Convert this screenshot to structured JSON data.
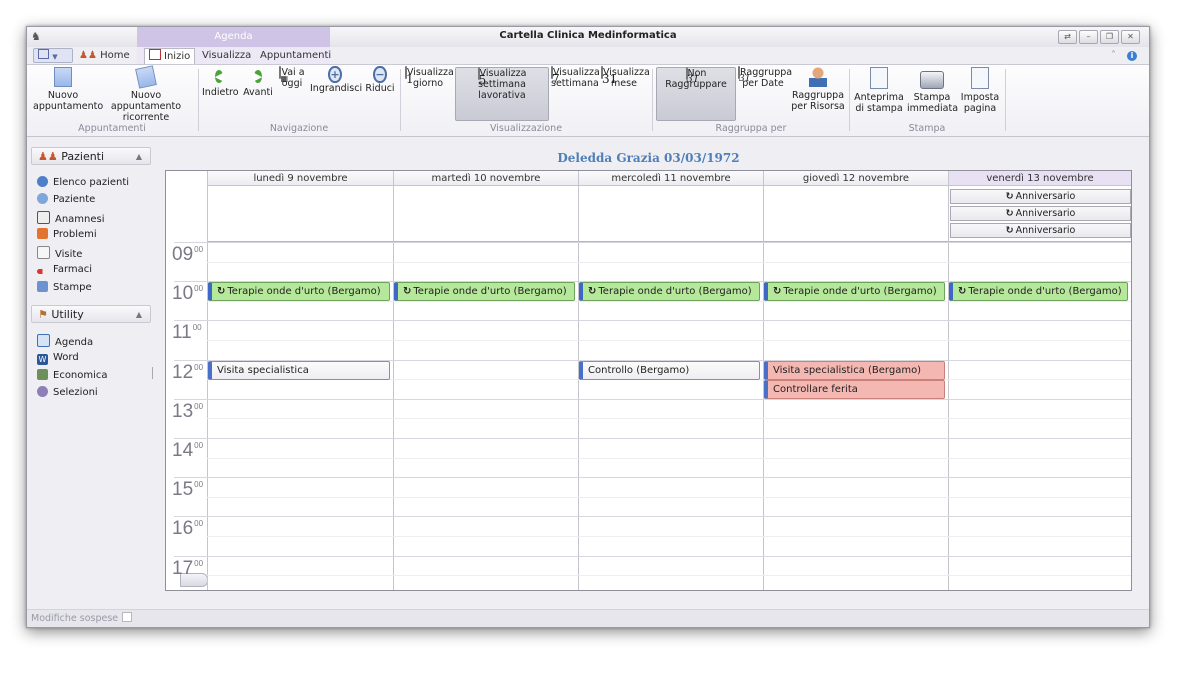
{
  "window": {
    "title": "Cartella Clinica Medinformatica",
    "context_tab_group": "Agenda"
  },
  "tabs": [
    {
      "label": "Home"
    },
    {
      "label": "Inizio"
    },
    {
      "label": "Visualizza"
    },
    {
      "label": "Appuntamenti"
    }
  ],
  "ribbon": {
    "groups": {
      "appuntamenti": "Appuntamenti",
      "navigazione": "Navigazione",
      "visualizzazione": "Visualizzazione",
      "raggruppa": "Raggruppa per",
      "stampa": "Stampa"
    },
    "buttons": {
      "nuovo_line1": "Nuovo",
      "nuovo_line2": "appuntamento",
      "nuovo_ric_line1": "Nuovo appuntamento",
      "nuovo_ric_line2": "ricorrente",
      "indietro": "Indietro",
      "avanti": "Avanti",
      "vai_line1": "Vai a",
      "vai_line2": "oggi",
      "ingrandisci": "Ingrandisci",
      "riduci": "Riduci",
      "vis_giorno_line1": "Visualizza",
      "vis_giorno_line2": "giorno",
      "vis_setlav_line1": "Visualizza settimana",
      "vis_setlav_line2": "lavorativa",
      "vis_set_line1": "Visualizza",
      "vis_set_line2": "settimana",
      "vis_mese_line1": "Visualizza",
      "vis_mese_line2": "mese",
      "non_raggruppare": "Non Raggruppare",
      "ragg_date_line1": "Raggruppa",
      "ragg_date_line2": "per Date",
      "ragg_risorsa_line1": "Raggruppa",
      "ragg_risorsa_line2": "per Risorsa",
      "anteprima_line1": "Anteprima",
      "anteprima_line2": "di stampa",
      "stampa_line1": "Stampa",
      "stampa_line2": "immediata",
      "imposta_line1": "Imposta",
      "imposta_line2": "pagina"
    },
    "calendar_icons": {
      "giorno": "1",
      "settimana_lavorativa": "5",
      "settimana": "7",
      "mese": "31",
      "non_raggruppare": "31",
      "raggruppa_date": "31"
    }
  },
  "nav": {
    "pazienti": {
      "header": "Pazienti",
      "items": [
        "Elenco pazienti",
        "Paziente",
        "Anamnesi",
        "Problemi",
        "Visite",
        "Farmaci",
        "Stampe"
      ]
    },
    "utility": {
      "header": "Utility",
      "items": [
        "Agenda",
        "Word",
        "Economica",
        "Selezioni"
      ]
    }
  },
  "status": {
    "text": "Modifiche sospese"
  },
  "calendar": {
    "patient": "Deledda Grazia 03/03/1972",
    "days": [
      "lunedì 9 novembre",
      "martedì 10 novembre",
      "mercoledì 11 novembre",
      "giovedì 12 novembre",
      "venerdì 13 novembre"
    ],
    "allday_events": [
      "Anniversario",
      "Anniversario",
      "Anniversario"
    ],
    "hours": [
      {
        "h": "09",
        "m": "00"
      },
      {
        "h": "10",
        "m": "00"
      },
      {
        "h": "11",
        "m": "00"
      },
      {
        "h": "12",
        "m": "00"
      },
      {
        "h": "13",
        "m": "00"
      },
      {
        "h": "14",
        "m": "00"
      },
      {
        "h": "15",
        "m": "00"
      },
      {
        "h": "16",
        "m": "00"
      },
      {
        "h": "17",
        "m": "00"
      }
    ],
    "appointments": [
      {
        "day": 0,
        "start": "10:00",
        "text": "Terapie onde d'urto (Bergamo)",
        "recurring": true,
        "color": "green"
      },
      {
        "day": 1,
        "start": "10:00",
        "text": "Terapie onde d'urto (Bergamo)",
        "recurring": true,
        "color": "green"
      },
      {
        "day": 2,
        "start": "10:00",
        "text": "Terapie onde d'urto (Bergamo)",
        "recurring": true,
        "color": "green"
      },
      {
        "day": 3,
        "start": "10:00",
        "text": "Terapie onde d'urto (Bergamo)",
        "recurring": true,
        "color": "green"
      },
      {
        "day": 4,
        "start": "10:00",
        "text": "Terapie onde d'urto (Bergamo)",
        "recurring": true,
        "color": "green"
      },
      {
        "day": 0,
        "start": "12:00",
        "text": "Visita specialistica",
        "recurring": false,
        "color": "gray"
      },
      {
        "day": 2,
        "start": "12:00",
        "text": "Controllo (Bergamo)",
        "recurring": false,
        "color": "gray"
      },
      {
        "day": 3,
        "start": "12:00",
        "text": "Visita specialistica (Bergamo)",
        "recurring": false,
        "color": "red"
      },
      {
        "day": 3,
        "start": "12:30",
        "text": "Controllare ferita",
        "recurring": false,
        "color": "red"
      }
    ],
    "colors": {
      "green": "#b5e89a",
      "red": "#f5b7b2",
      "accent": "#4a6fc9",
      "title": "#4f7fb6"
    }
  }
}
